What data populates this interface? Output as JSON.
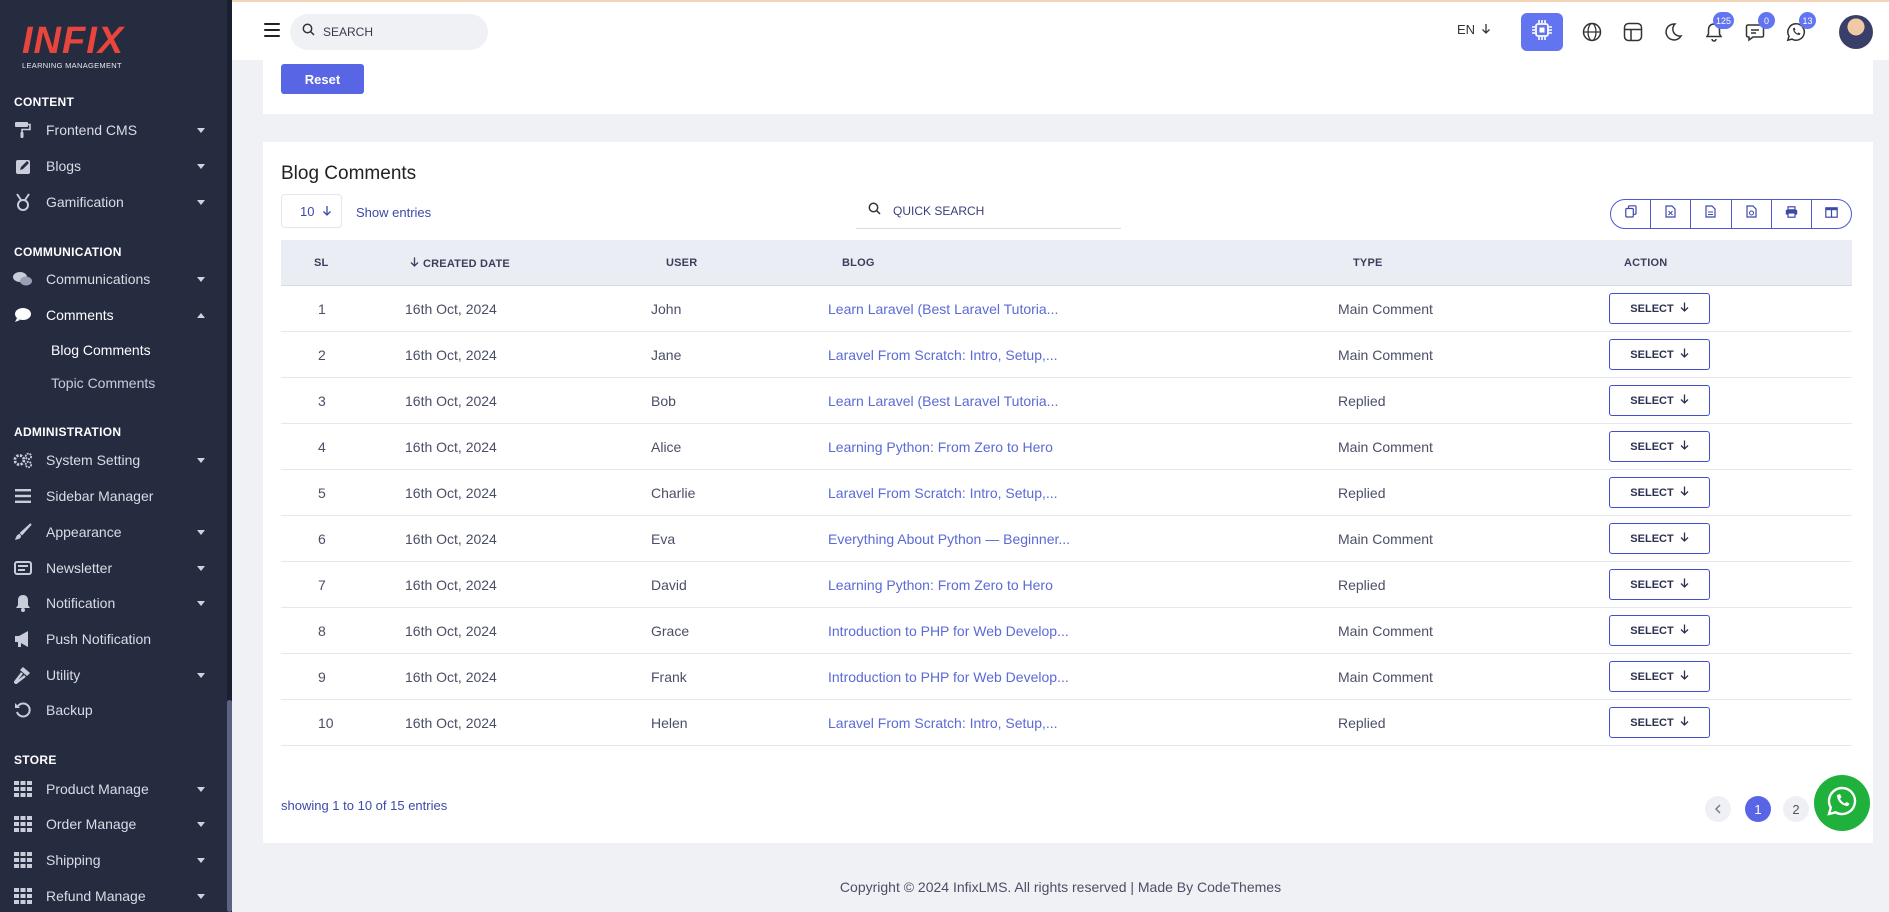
{
  "brand": {
    "logo_text": "INFIX",
    "logo_sub": "LEARNING MANAGEMENT"
  },
  "sidebar": {
    "sections": {
      "content": "CONTENT",
      "communication": "COMMUNICATION",
      "administration": "ADMINISTRATION",
      "store": "STORE"
    },
    "items": {
      "frontend_cms": "Frontend CMS",
      "blogs": "Blogs",
      "gamification": "Gamification",
      "communications": "Communications",
      "comments": "Comments",
      "blog_comments": "Blog Comments",
      "topic_comments": "Topic Comments",
      "system_setting": "System Setting",
      "sidebar_manager": "Sidebar Manager",
      "appearance": "Appearance",
      "newsletter": "Newsletter",
      "notification": "Notification",
      "push_notification": "Push Notification",
      "utility": "Utility",
      "backup": "Backup",
      "product_manage": "Product Manage",
      "order_manage": "Order Manage",
      "shipping": "Shipping",
      "refund_manage": "Refund Manage"
    },
    "icons": {
      "frontend_cms": "paint-roller-icon",
      "blogs": "edit-icon",
      "gamification": "medal-icon",
      "communications": "chat-bubbles-icon",
      "comments": "comment-icon",
      "system_setting": "gears-icon",
      "sidebar_manager": "bars-icon",
      "appearance": "brush-icon",
      "newsletter": "envelope-icon",
      "notification": "bell-icon",
      "push_notification": "megaphone-icon",
      "utility": "hammer-icon",
      "backup": "restore-icon",
      "grid": "grid-icon"
    }
  },
  "header": {
    "search_placeholder": "SEARCH",
    "language": "EN",
    "badges": {
      "notifications": "125",
      "messages": "0",
      "whatsapp": "13"
    }
  },
  "filter": {
    "reset_label": "Reset"
  },
  "blog_comments": {
    "title": "Blog Comments",
    "entries_value": "10",
    "entries_label": "Show entries",
    "quick_search_placeholder": "QUICK SEARCH",
    "columns": {
      "sl": "SL",
      "created_date": "CREATED DATE",
      "user": "USER",
      "blog": "BLOG",
      "type": "TYPE",
      "action": "ACTION"
    },
    "action_label": "SELECT",
    "rows": [
      {
        "sl": "1",
        "date": "16th Oct, 2024",
        "user": "John",
        "blog": "Learn Laravel (Best Laravel Tutoria...",
        "type": "Main Comment"
      },
      {
        "sl": "2",
        "date": "16th Oct, 2024",
        "user": "Jane",
        "blog": "Laravel From Scratch: Intro, Setup,...",
        "type": "Main Comment"
      },
      {
        "sl": "3",
        "date": "16th Oct, 2024",
        "user": "Bob",
        "blog": "Learn Laravel (Best Laravel Tutoria...",
        "type": "Replied"
      },
      {
        "sl": "4",
        "date": "16th Oct, 2024",
        "user": "Alice",
        "blog": "Learning Python: From Zero to Hero",
        "type": "Main Comment"
      },
      {
        "sl": "5",
        "date": "16th Oct, 2024",
        "user": "Charlie",
        "blog": "Laravel From Scratch: Intro, Setup,...",
        "type": "Replied"
      },
      {
        "sl": "6",
        "date": "16th Oct, 2024",
        "user": "Eva",
        "blog": "Everything About Python — Beginner...",
        "type": "Main Comment"
      },
      {
        "sl": "7",
        "date": "16th Oct, 2024",
        "user": "David",
        "blog": "Learning Python: From Zero to Hero",
        "type": "Replied"
      },
      {
        "sl": "8",
        "date": "16th Oct, 2024",
        "user": "Grace",
        "blog": "Introduction to PHP for Web Develop...",
        "type": "Main Comment"
      },
      {
        "sl": "9",
        "date": "16th Oct, 2024",
        "user": "Frank",
        "blog": "Introduction to PHP for Web Develop...",
        "type": "Main Comment"
      },
      {
        "sl": "10",
        "date": "16th Oct, 2024",
        "user": "Helen",
        "blog": "Laravel From Scratch: Intro, Setup,...",
        "type": "Replied"
      }
    ],
    "showing": "showing 1 to 10 of 15 entries",
    "pages": [
      "1",
      "2"
    ]
  },
  "footer": {
    "copyright": "Copyright © 2024 InfixLMS. All rights reserved | Made By CodeThemes"
  },
  "colors": {
    "accent": "#5866e6",
    "sidebar_bg": "#262c40",
    "logo_red": "#e8453c",
    "whatsapp_green": "#1fb13b"
  }
}
